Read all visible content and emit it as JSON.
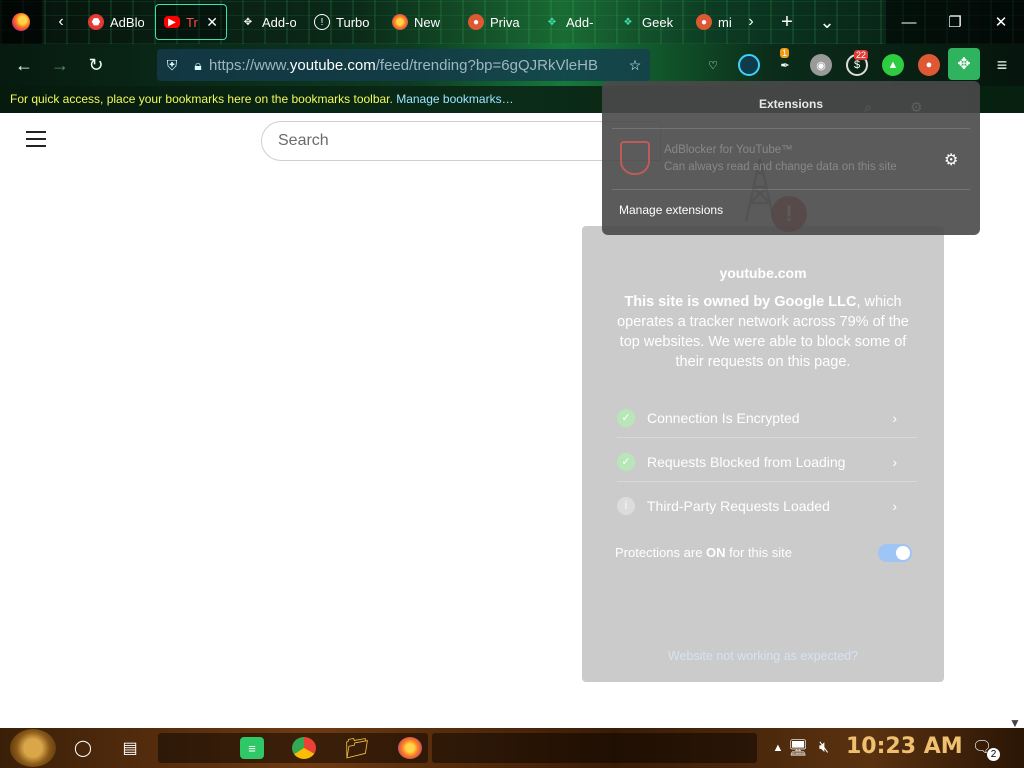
{
  "tabs": [
    {
      "label": "AdBlo",
      "icon": "adblock-icon",
      "color": "#e53935"
    },
    {
      "label": "Tre",
      "icon": "youtube-icon",
      "color": "#ff0000",
      "active": true
    },
    {
      "label": "Add-o",
      "icon": "puzzle-icon",
      "color": "#ffffff"
    },
    {
      "label": "Turbo",
      "icon": "info-icon",
      "color": "#ffffff"
    },
    {
      "label": "New",
      "icon": "firefox-icon",
      "color": "#ff7a1a"
    },
    {
      "label": "Priva",
      "icon": "duckduckgo-icon",
      "color": "#de5833"
    },
    {
      "label": "Add-",
      "icon": "puzzle-icon",
      "color": "#3fe0b0"
    },
    {
      "label": "Geek",
      "icon": "geek-icon",
      "color": "#3fe0b0"
    },
    {
      "label": "mir",
      "icon": "duckduckgo-icon",
      "color": "#de5833"
    }
  ],
  "tab_close_glyph": "✕",
  "new_tab_glyph": "+",
  "list_all_tabs_glyph": "⌄",
  "window": {
    "minimize": "—",
    "maximize": "❐",
    "close": "✕"
  },
  "url": {
    "prefix": "https://www.",
    "domain": "youtube.com",
    "path": "/feed/trending?bp=6gQJRkVleHB"
  },
  "badges": {
    "ext1": "1",
    "ext2": "22"
  },
  "bookmarks_msg": "For quick access, place your bookmarks here on the bookmarks toolbar.",
  "bookmarks_link": "Manage bookmarks…",
  "youtube": {
    "search_placeholder": "Search"
  },
  "extensions_popup": {
    "title": "Extensions",
    "ext_name": "AdBlocker for YouTube™",
    "ext_desc": "Can always read and change data on this site",
    "manage": "Manage extensions"
  },
  "privacy": {
    "domain": "youtube.com",
    "owner_bold": "This site is owned by Google LLC",
    "owner_rest": ", which operates a tracker network across 79% of the top websites. We were able to block some of their requests on this page.",
    "rows": [
      {
        "label": "Connection Is Encrypted",
        "status": "ok"
      },
      {
        "label": "Requests Blocked from Loading",
        "status": "ok"
      },
      {
        "label": "Third-Party Requests Loaded",
        "status": "info"
      }
    ],
    "protections_label_pre": "Protections are ",
    "protections_on": "ON",
    "protections_label_post": " for this site",
    "protections_enabled": true,
    "not_working": "Website not working as expected?"
  },
  "taskbar": {
    "clock": "10:23 AM",
    "notifications": "2"
  },
  "colors": {
    "accent_green": "#2fb35f",
    "active_tab_border": "#3fe0b0",
    "clock": "#f0c070"
  }
}
